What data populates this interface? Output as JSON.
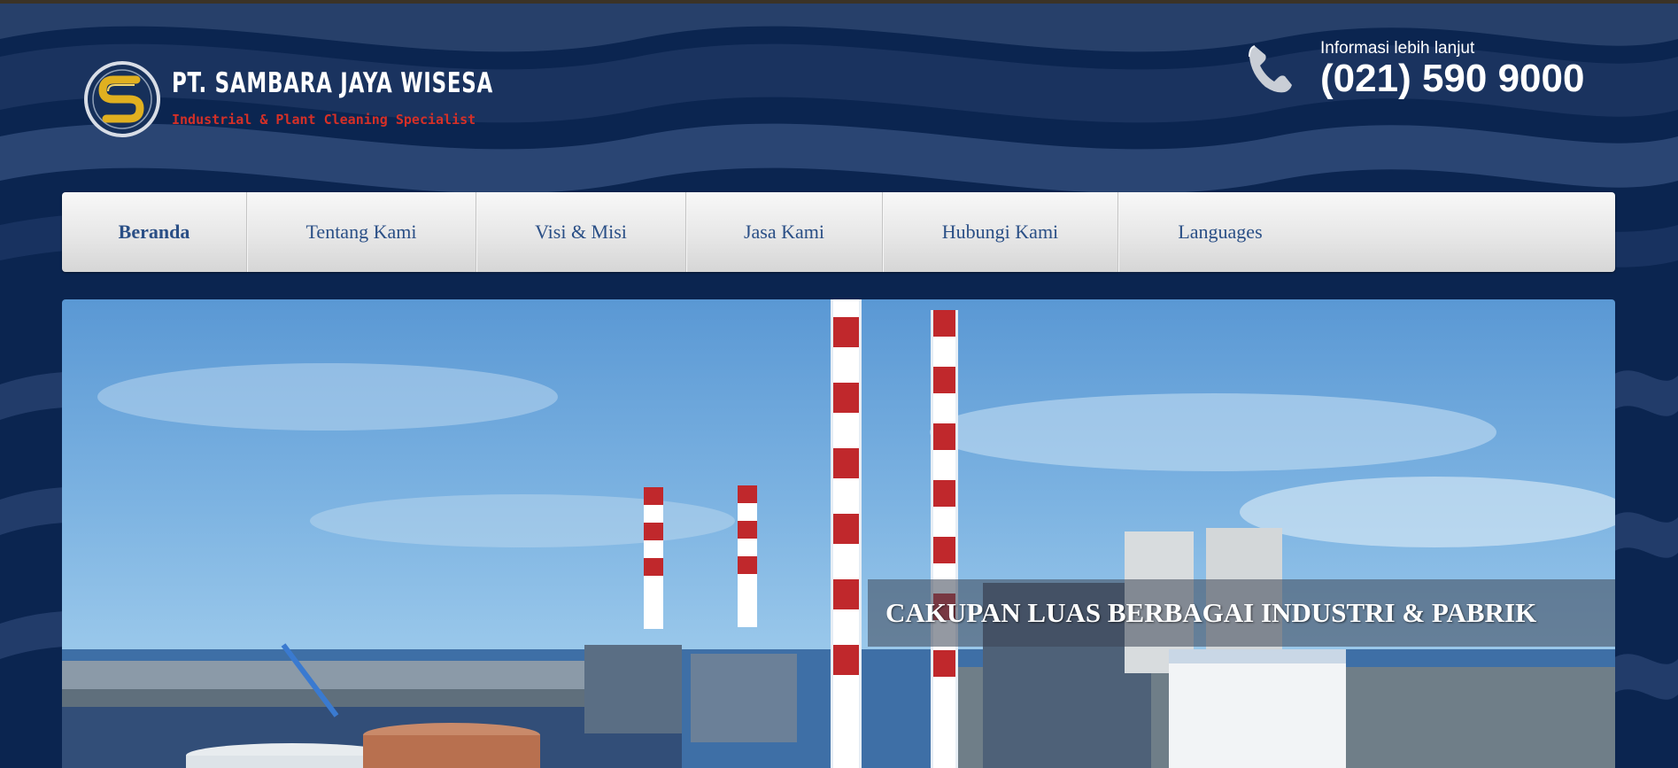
{
  "brand": {
    "name": "PT. SAMBARA JAYA WISESA",
    "tagline": "Industrial & Plant Cleaning Specialist",
    "logo_letter": "S"
  },
  "contact": {
    "label": "Informasi lebih lanjut",
    "phone": "(021) 590 9000",
    "icon": "phone-icon"
  },
  "nav": {
    "items": [
      {
        "label": "Beranda",
        "active": true
      },
      {
        "label": "Tentang Kami",
        "active": false
      },
      {
        "label": "Visi & Misi",
        "active": false
      },
      {
        "label": "Jasa Kami",
        "active": false
      },
      {
        "label": "Hubungi Kami",
        "active": false
      },
      {
        "label": "Languages",
        "active": false
      }
    ]
  },
  "hero": {
    "caption": "CAKUPAN LUAS BERBAGAI INDUSTRI & PABRIK"
  },
  "colors": {
    "background": "#0b2550",
    "nav_text": "#2a4f86",
    "tagline": "#d53027",
    "logo_gold": "#e0b020"
  }
}
